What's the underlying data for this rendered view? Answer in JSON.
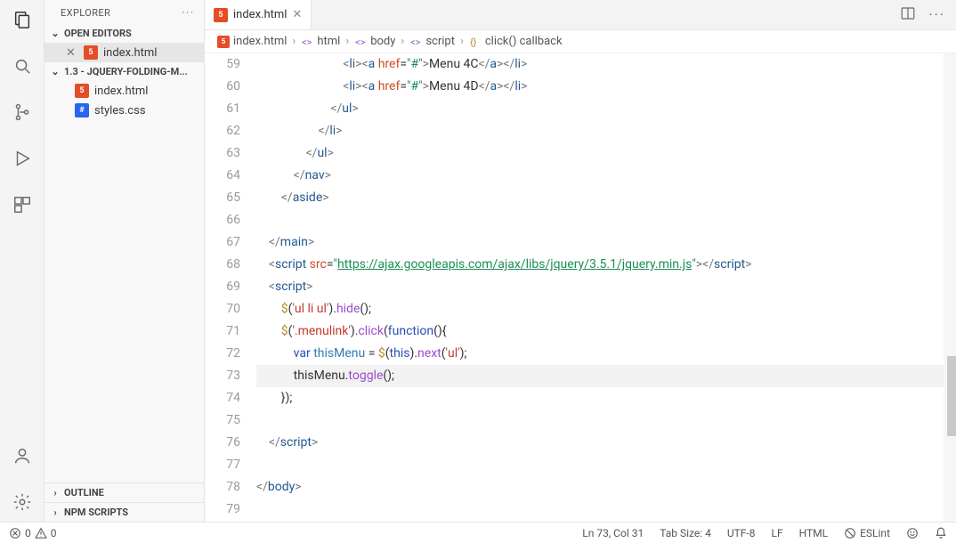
{
  "sidebar": {
    "title": "EXPLORER",
    "sections": {
      "open_editors": {
        "label": "OPEN EDITORS",
        "items": [
          {
            "name": "index.html",
            "type": "html"
          }
        ]
      },
      "folder": {
        "label": "1.3 - JQUERY-FOLDING-M...",
        "items": [
          {
            "name": "index.html",
            "type": "html"
          },
          {
            "name": "styles.css",
            "type": "css"
          }
        ]
      },
      "outline": {
        "label": "OUTLINE"
      },
      "npm": {
        "label": "NPM SCRIPTS"
      }
    }
  },
  "tabs": {
    "active": {
      "name": "index.html",
      "type": "html"
    }
  },
  "breadcrumbs": [
    {
      "icon": "html-badge",
      "text": "index.html"
    },
    {
      "icon": "tag",
      "text": "html"
    },
    {
      "icon": "tag",
      "text": "body"
    },
    {
      "icon": "tag",
      "text": "script"
    },
    {
      "icon": "brace",
      "text": "click() callback"
    }
  ],
  "editor": {
    "first_line_number": 59,
    "cursor_line": 73,
    "lines": [
      {
        "html": "                            <span class='pnc'>&lt;</span><span class='tg'>li</span><span class='pnc'>&gt;&lt;</span><span class='tg'>a</span> <span class='atr'>href</span>=<span class='str'>\"#\"</span><span class='pnc'>&gt;</span>Menu 4C<span class='pnc'>&lt;/</span><span class='tg'>a</span><span class='pnc'>&gt;&lt;/</span><span class='tg'>li</span><span class='pnc'>&gt;</span>"
      },
      {
        "html": "                            <span class='pnc'>&lt;</span><span class='tg'>li</span><span class='pnc'>&gt;&lt;</span><span class='tg'>a</span> <span class='atr'>href</span>=<span class='str'>\"#\"</span><span class='pnc'>&gt;</span>Menu 4D<span class='pnc'>&lt;/</span><span class='tg'>a</span><span class='pnc'>&gt;&lt;/</span><span class='tg'>li</span><span class='pnc'>&gt;</span>"
      },
      {
        "html": "                        <span class='pnc'>&lt;/</span><span class='tg'>ul</span><span class='pnc'>&gt;</span>"
      },
      {
        "html": "                    <span class='pnc'>&lt;/</span><span class='tg'>li</span><span class='pnc'>&gt;</span>"
      },
      {
        "html": "                <span class='pnc'>&lt;/</span><span class='tg'>ul</span><span class='pnc'>&gt;</span>"
      },
      {
        "html": "            <span class='pnc'>&lt;/</span><span class='tg'>nav</span><span class='pnc'>&gt;</span>"
      },
      {
        "html": "        <span class='pnc'>&lt;/</span><span class='tg'>aside</span><span class='pnc'>&gt;</span>"
      },
      {
        "html": ""
      },
      {
        "html": "    <span class='pnc'>&lt;/</span><span class='tg'>main</span><span class='pnc'>&gt;</span>"
      },
      {
        "html": "    <span class='pnc'>&lt;</span><span class='tg'>script</span> <span class='atr'>src</span>=<span class='str'>\"</span><span class='url'>https://ajax.googleapis.com/ajax/libs/jquery/3.5.1/jquery.min.js</span><span class='str'>\"</span><span class='pnc'>&gt;&lt;/</span><span class='tg'>script</span><span class='pnc'>&gt;</span>"
      },
      {
        "html": "    <span class='pnc'>&lt;</span><span class='tg'>script</span><span class='pnc'>&gt;</span>"
      },
      {
        "html": "        <span class='jq'>$</span>(<span class='sel'>'ul li ul'</span>).<span class='fn'>hide</span>();"
      },
      {
        "html": "        <span class='jq'>$</span>(<span class='sel'>'.menulink'</span>).<span class='fn'>click</span>(<span class='kw'>function</span>(){"
      },
      {
        "html": "            <span class='kw'>var</span> <span class='var'>thisMenu</span> = <span class='jq'>$</span>(<span class='kw'>this</span>).<span class='fn'>next</span>(<span class='sel'>'ul'</span>);"
      },
      {
        "html": "            <span class='obj'>thisMenu</span>.<span class='fn'>toggle</span>();"
      },
      {
        "html": "        });"
      },
      {
        "html": ""
      },
      {
        "html": "    <span class='pnc'>&lt;/</span><span class='tg'>script</span><span class='pnc'>&gt;</span>"
      },
      {
        "html": ""
      },
      {
        "html": "<span class='pnc'>&lt;/</span><span class='tg'>body</span><span class='pnc'>&gt;</span>"
      },
      {
        "html": ""
      }
    ]
  },
  "status": {
    "errors": "0",
    "warnings": "0",
    "cursor": "Ln 73, Col 31",
    "tab_size": "Tab Size: 4",
    "encoding": "UTF-8",
    "eol": "LF",
    "language": "HTML",
    "eslint": "ESLint"
  }
}
